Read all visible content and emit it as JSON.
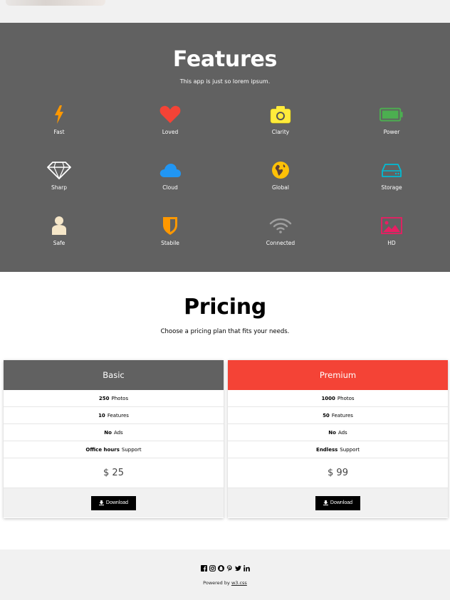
{
  "features_section": {
    "title": "Features",
    "subtitle": "This app is just so lorem ipsum.",
    "items": [
      {
        "label": "Fast",
        "icon": "bolt-icon",
        "color": "#ff9800"
      },
      {
        "label": "Loved",
        "icon": "heart-icon",
        "color": "#f44336"
      },
      {
        "label": "Clarity",
        "icon": "camera-icon",
        "color": "#ffeb3b"
      },
      {
        "label": "Power",
        "icon": "battery-icon",
        "color": "#4caf50"
      },
      {
        "label": "Sharp",
        "icon": "diamond-icon",
        "color": "#ffffff"
      },
      {
        "label": "Cloud",
        "icon": "cloud-icon",
        "color": "#2196f3"
      },
      {
        "label": "Global",
        "icon": "globe-icon",
        "color": "#ffc107"
      },
      {
        "label": "Storage",
        "icon": "hdd-icon",
        "color": "#00bcd4"
      },
      {
        "label": "Safe",
        "icon": "user-icon",
        "color": "#f5e6c8"
      },
      {
        "label": "Stabile",
        "icon": "shield-icon",
        "color": "#ff9800"
      },
      {
        "label": "Connected",
        "icon": "wifi-icon",
        "color": "#9e9e9e"
      },
      {
        "label": "HD",
        "icon": "image-icon",
        "color": "#e91e63"
      }
    ]
  },
  "pricing_section": {
    "title": "Pricing",
    "subtitle": "Choose a pricing plan that fits your needs.",
    "plans": [
      {
        "name": "Basic",
        "header_color": "#616161",
        "rows": [
          {
            "bold": "250",
            "text": "Photos"
          },
          {
            "bold": "10",
            "text": "Features"
          },
          {
            "bold": "No",
            "text": "Ads"
          },
          {
            "bold": "Office hours",
            "text": "Support"
          }
        ],
        "price": "$ 25",
        "button_label": "Download"
      },
      {
        "name": "Premium",
        "header_color": "#f44336",
        "rows": [
          {
            "bold": "1000",
            "text": "Photos"
          },
          {
            "bold": "50",
            "text": "Features"
          },
          {
            "bold": "No",
            "text": "Ads"
          },
          {
            "bold": "Endless",
            "text": "Support"
          }
        ],
        "price": "$ 99",
        "button_label": "Download"
      }
    ]
  },
  "footer": {
    "socials": [
      "facebook-icon",
      "instagram-icon",
      "snapchat-icon",
      "pinterest-icon",
      "twitter-icon",
      "linkedin-icon"
    ],
    "powered_prefix": "Powered by",
    "powered_link": "w3.css"
  },
  "colors": {
    "dark_gray": "#616161",
    "light_gray": "#f1f1f1",
    "red": "#f44336"
  }
}
